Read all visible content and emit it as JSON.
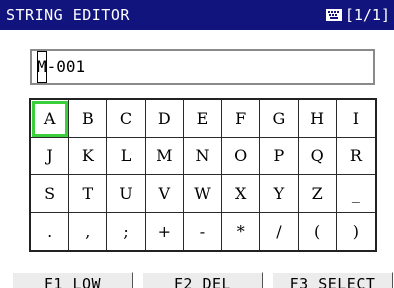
{
  "title": "STRING EDITOR",
  "page_indicator": "[1/1]",
  "icons": {
    "keyboard": "keyboard-icon"
  },
  "input": {
    "value_first_char": "M",
    "value_rest": "-001"
  },
  "keyboard": {
    "selected_key": "A",
    "rows": [
      [
        "A",
        "B",
        "C",
        "D",
        "E",
        "F",
        "G",
        "H",
        "I"
      ],
      [
        "J",
        "K",
        "L",
        "M",
        "N",
        "O",
        "P",
        "Q",
        "R"
      ],
      [
        "S",
        "T",
        "U",
        "V",
        "W",
        "X",
        "Y",
        "Z",
        "_"
      ],
      [
        ".",
        ",",
        ";",
        "+",
        "-",
        "*",
        "/",
        "(",
        ")"
      ]
    ]
  },
  "function_keys": [
    {
      "label": "F1 LOW"
    },
    {
      "label": "F2 DEL"
    },
    {
      "label": "F3 SELECT"
    }
  ],
  "colors": {
    "titlebar": "#12147e",
    "selection": "#3ccf3c"
  }
}
